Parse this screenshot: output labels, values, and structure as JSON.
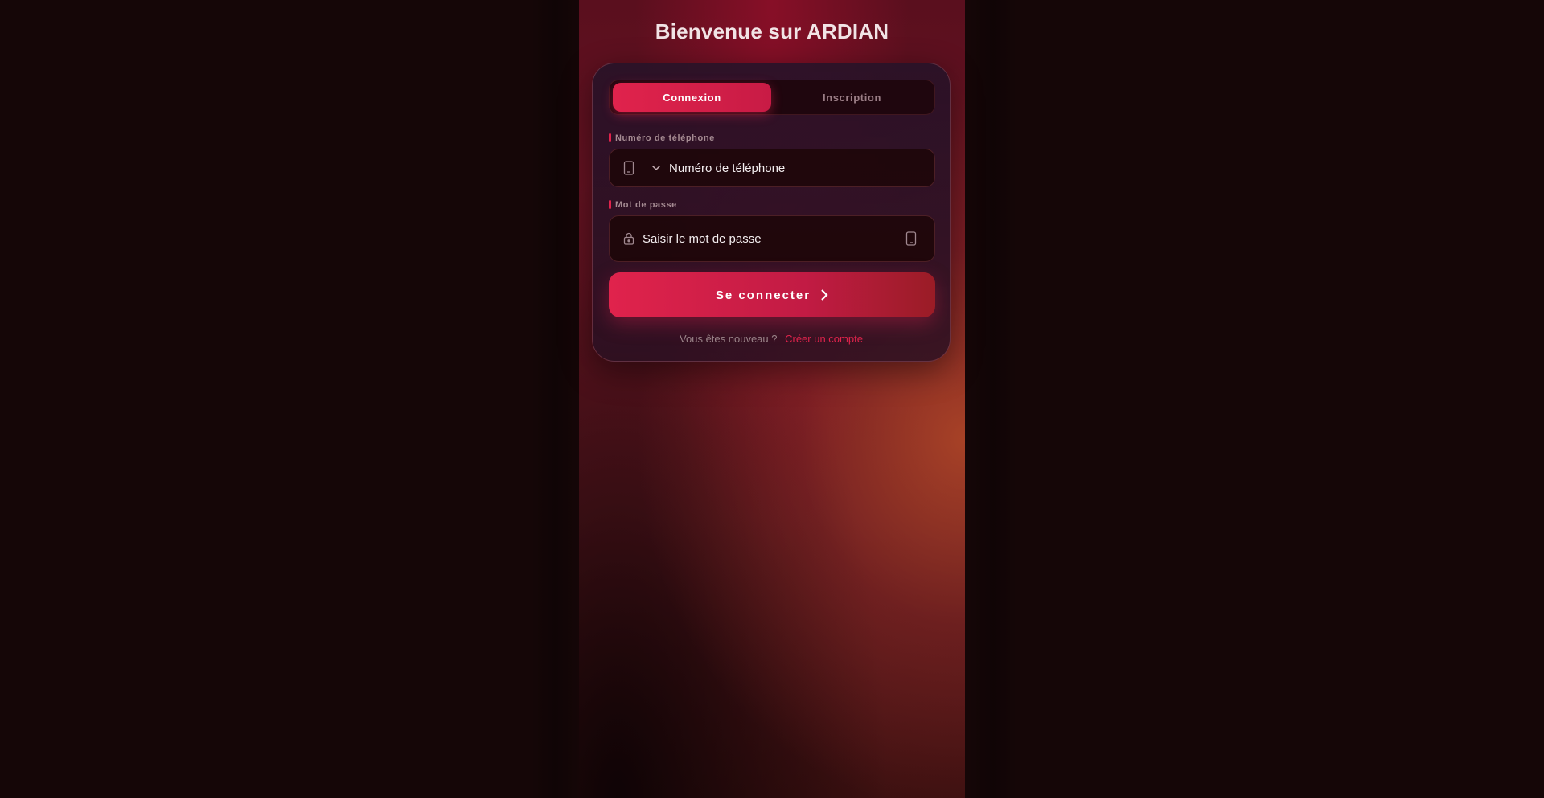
{
  "page": {
    "title": "Bienvenue sur ARDIAN"
  },
  "tabs": {
    "login_label": "Connexion",
    "signup_label": "Inscription"
  },
  "phone": {
    "label": "Numéro de téléphone",
    "placeholder": "Numéro de téléphone",
    "icon": "phone-icon"
  },
  "password": {
    "label": "Mot de passe",
    "placeholder": "Saisir le mot de passe",
    "icon": "lock-icon",
    "toggle_icon": "phone-icon"
  },
  "submit": {
    "label": "Se connecter",
    "icon": "chevron-right-icon"
  },
  "footer": {
    "prompt": "Vous êtes nouveau ?",
    "link": "Créer un compte"
  },
  "colors": {
    "accent": "#e0234c",
    "background": "#150607"
  }
}
